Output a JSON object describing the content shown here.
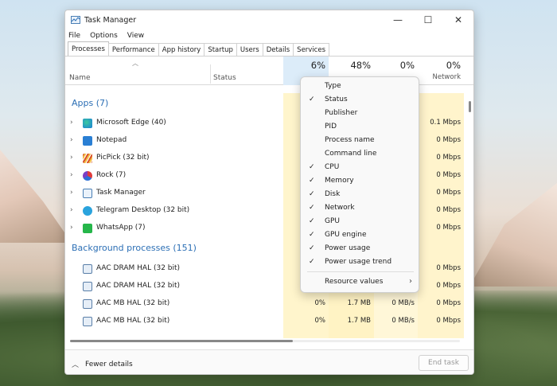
{
  "window": {
    "title": "Task Manager",
    "minimize": "—",
    "maximize": "☐",
    "close": "✕"
  },
  "menubar": [
    "File",
    "Options",
    "View"
  ],
  "tabs": [
    "Processes",
    "Performance",
    "App history",
    "Startup",
    "Users",
    "Details",
    "Services"
  ],
  "header": {
    "name": "Name",
    "status": "Status",
    "cpu_pct": "6%",
    "mem_pct": "48%",
    "disk_pct": "0%",
    "net_pct": "0%",
    "net_label": "Network"
  },
  "groups": {
    "apps": "Apps (7)",
    "background": "Background processes (151)"
  },
  "apps": [
    {
      "name": "Microsoft Edge (40)",
      "net": "0.1 Mbps"
    },
    {
      "name": "Notepad",
      "net": "0 Mbps"
    },
    {
      "name": "PicPick (32 bit)",
      "net": "0 Mbps"
    },
    {
      "name": "Rock (7)",
      "net": "0 Mbps"
    },
    {
      "name": "Task Manager",
      "net": "0 Mbps"
    },
    {
      "name": "Telegram Desktop (32 bit)",
      "net": "0 Mbps"
    },
    {
      "name": "WhatsApp (7)",
      "net": "0 Mbps"
    }
  ],
  "background": [
    {
      "name": "AAC DRAM HAL (32 bit)",
      "cpu": "",
      "mem": "",
      "disk": "",
      "net": "0 Mbps"
    },
    {
      "name": "AAC DRAM HAL (32 bit)",
      "cpu": "",
      "mem": "",
      "disk": "",
      "net": "0 Mbps"
    },
    {
      "name": "AAC MB HAL (32 bit)",
      "cpu": "0%",
      "mem": "1.7 MB",
      "disk": "0 MB/s",
      "net": "0 Mbps"
    },
    {
      "name": "AAC MB HAL (32 bit)",
      "cpu": "0%",
      "mem": "1.7 MB",
      "disk": "0 MB/s",
      "net": "0 Mbps"
    }
  ],
  "context_menu": {
    "items": [
      {
        "label": "Type",
        "checked": ""
      },
      {
        "label": "Status",
        "checked": "✓"
      },
      {
        "label": "Publisher",
        "checked": ""
      },
      {
        "label": "PID",
        "checked": ""
      },
      {
        "label": "Process name",
        "checked": ""
      },
      {
        "label": "Command line",
        "checked": ""
      },
      {
        "label": "CPU",
        "checked": "✓"
      },
      {
        "label": "Memory",
        "checked": "✓"
      },
      {
        "label": "Disk",
        "checked": "✓"
      },
      {
        "label": "Network",
        "checked": "✓"
      },
      {
        "label": "GPU",
        "checked": "✓"
      },
      {
        "label": "GPU engine",
        "checked": "✓"
      },
      {
        "label": "Power usage",
        "checked": "✓"
      },
      {
        "label": "Power usage trend",
        "checked": "✓"
      }
    ],
    "submenu": {
      "label": "Resource values",
      "arrow": "›"
    }
  },
  "footer": {
    "fewer_details": "Fewer details",
    "end_task": "End task"
  }
}
